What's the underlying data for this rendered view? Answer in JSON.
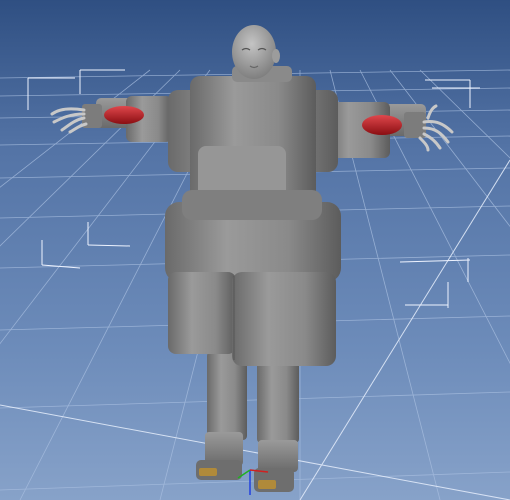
{
  "viewport": {
    "background_top": "#2f4f82",
    "background_bottom": "#87a2c9",
    "grid_color": "#a9bfe0",
    "grid_major_color": "#e6eefc",
    "model_color": "#8d8d8d",
    "accent_red": "#b3161c",
    "axis_x_color": "#d02020",
    "axis_y_color": "#20b020",
    "axis_z_color": "#2040e0"
  },
  "scene": {
    "figure": "humanoid-robot-mesh-in-t-pose",
    "grid": "perspective-floor-grid",
    "selection_markers": "corner-bracket-markers",
    "gizmo": "xyz-axis-gizmo"
  }
}
